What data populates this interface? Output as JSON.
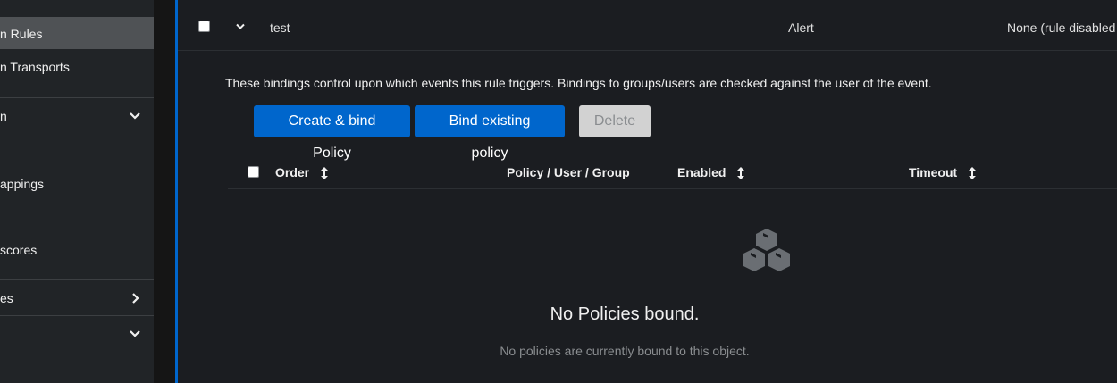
{
  "sidebar": {
    "items": [
      {
        "label": "n Rules",
        "active": true
      },
      {
        "label": "n Transports"
      },
      {
        "label": "n",
        "chevron": "chevron-down-icon"
      },
      {
        "label": "appings"
      },
      {
        "label": " scores"
      },
      {
        "label": "es",
        "chevron": "chevron-right-icon"
      },
      {
        "label": "",
        "chevron": "chevron-down-icon"
      }
    ]
  },
  "rule_row": {
    "name": "test",
    "severity": "Alert",
    "transport": "None (rule disabled"
  },
  "bindings": {
    "description": "These bindings control upon which events this rule triggers. Bindings to groups/users are checked against the user of the event.",
    "buttons": {
      "create": "Create & bind Policy",
      "bind_existing": "Bind existing policy",
      "delete": "Delete"
    },
    "table": {
      "headers": {
        "order": "Order",
        "policy": "Policy / User / Group",
        "enabled": "Enabled",
        "timeout": "Timeout"
      }
    },
    "empty": {
      "icon": "cubes-icon",
      "title": "No Policies bound.",
      "body": "No policies are currently bound to this object."
    }
  },
  "colors": {
    "accent": "#0066cc",
    "sidebar_bg": "#212427",
    "main_bg": "#1b1d21"
  }
}
